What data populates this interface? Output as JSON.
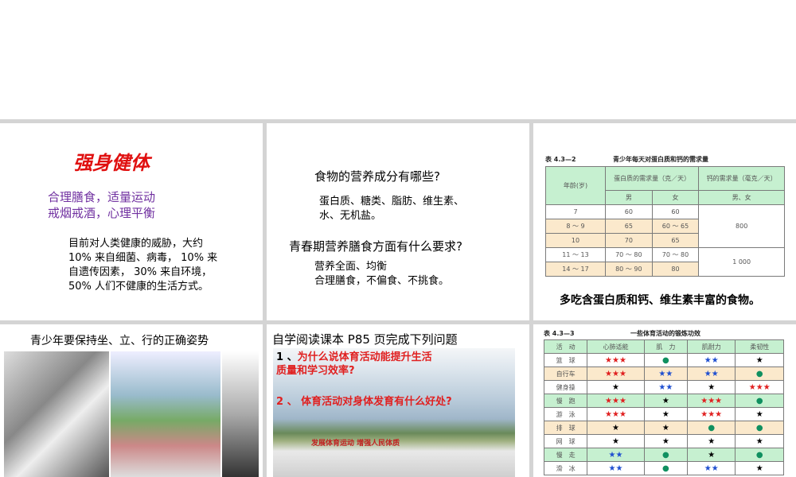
{
  "slide1": {
    "title": "强身健体",
    "line1": "合理膳食，适量运动",
    "line2": "戒烟戒酒，心理平衡",
    "body": [
      "目前对人类健康的威胁，大约",
      "10% 来自细菌、病毒， 10% 来",
      "自遗传因素， 30% 来自环境，",
      "50% 人们不健康的生活方式。"
    ]
  },
  "slide2": {
    "q1": "食物的营养成分有哪些?",
    "a1": [
      "蛋白质、糖类、脂肪、维生素、",
      "水、无机盐。"
    ],
    "q2": "青春期营养膳食方面有什么要求?",
    "a2": [
      "营养全面、均衡",
      "合理膳食，不偏食、不挑食。"
    ]
  },
  "slide3": {
    "table_no": "表 4.3—2",
    "caption": "青少年每天对蛋白质和钙的需求量",
    "h_age": "年龄(岁)",
    "h_protein": "蛋白质的需求量（克／天）",
    "h_calcium": "钙的需求量（毫克／天）",
    "h_male": "男",
    "h_female": "女",
    "h_both": "男、女",
    "rows": [
      [
        "7",
        "60",
        "60"
      ],
      [
        "8 ～ 9",
        "65",
        "60 ～ 65"
      ],
      [
        "10",
        "70",
        "65"
      ],
      [
        "11 ～ 13",
        "70 ～ 80",
        "70 ～ 80"
      ],
      [
        "14 ～ 17",
        "80 ～ 90",
        "80"
      ]
    ],
    "calcium": [
      "800",
      "1 000"
    ],
    "note": "多吃含蛋白质和钙、维生素丰富的食物。"
  },
  "slide4": {
    "title": "青少年要保持坐、立、行的正确姿势"
  },
  "slide5": {
    "title": "自学阅读课本 P85 页完成下列问题",
    "q1_num": "1 、",
    "q1": "为什么说体育活动能提升生活",
    "q1b": "质量和学习效率?",
    "q2": "2 、 体育活动对身体发育有什么好处?",
    "banner": "发展体育运动  增强人民体质"
  },
  "slide6": {
    "table_no": "表 4.3—3",
    "caption": "一些体育活动的锻炼功效",
    "headers": [
      "活　动",
      "心肺适能",
      "肌　力",
      "肌耐力",
      "柔韧性"
    ],
    "rows": [
      [
        "篮　球",
        "r3",
        "dot",
        "b2",
        "k1"
      ],
      [
        "自行车",
        "r3",
        "b2",
        "b2",
        "dot"
      ],
      [
        "健身操",
        "k1",
        "b2",
        "k1",
        "r3"
      ],
      [
        "慢　跑",
        "r3",
        "k1",
        "r3",
        "dot"
      ],
      [
        "游　泳",
        "r3",
        "k1",
        "r3",
        "k1"
      ],
      [
        "排　球",
        "k1",
        "k1",
        "dot",
        "dot"
      ],
      [
        "网　球",
        "k1",
        "k1",
        "k1",
        "k1"
      ],
      [
        "慢　走",
        "b2",
        "dot",
        "k1",
        "dot"
      ],
      [
        "滑　冰",
        "b2",
        "dot",
        "b2",
        "k1"
      ]
    ]
  }
}
